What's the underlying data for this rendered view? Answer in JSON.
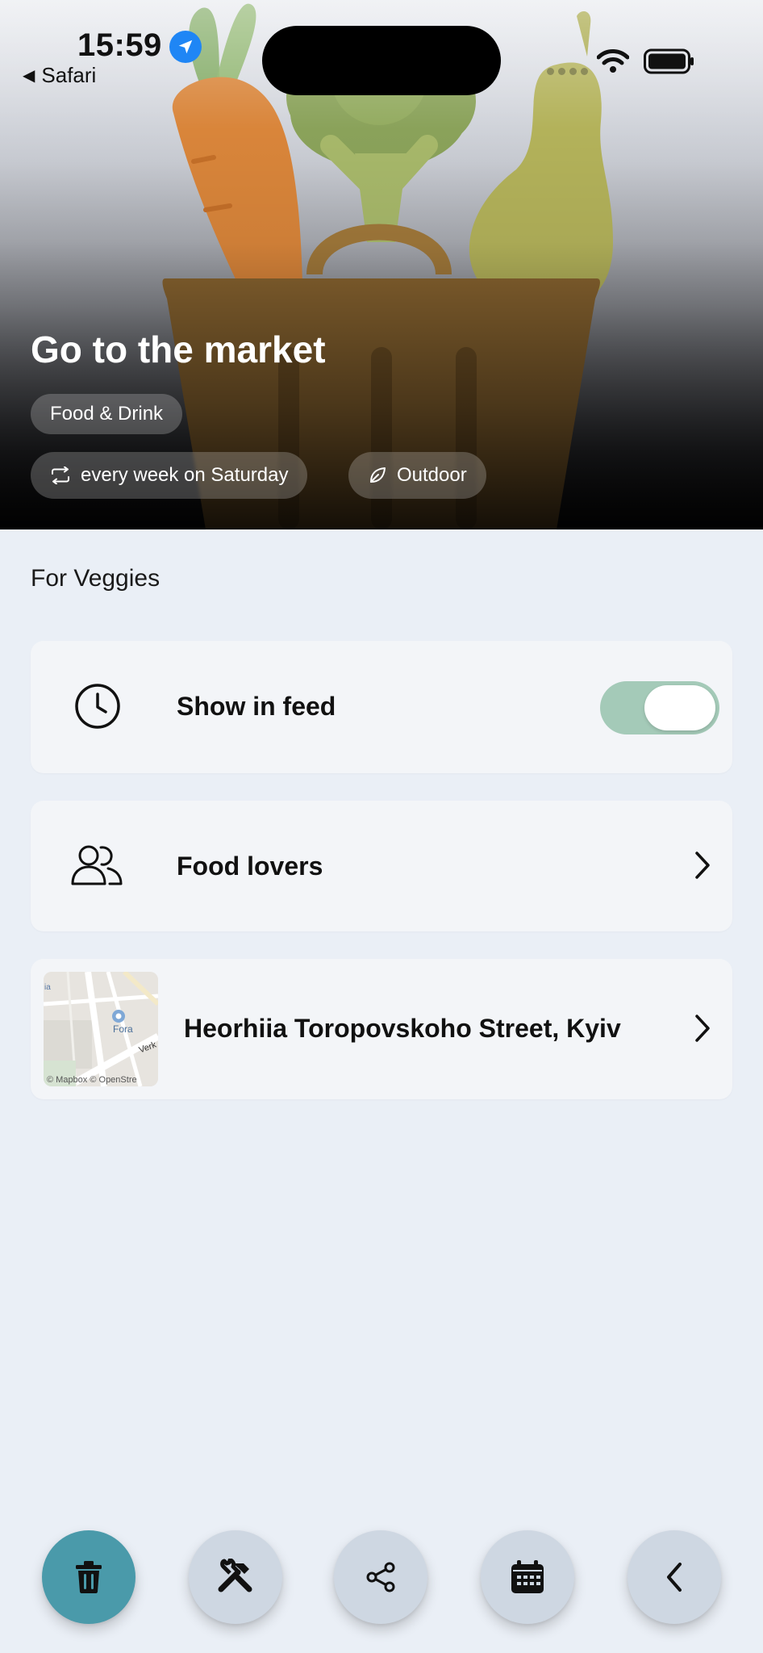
{
  "status_bar": {
    "time": "15:59",
    "back_app": "Safari"
  },
  "hero": {
    "title": "Go to the market",
    "category": "Food & Drink",
    "repeat": "every week on Saturday",
    "place_type": "Outdoor"
  },
  "main": {
    "section_title": "For Veggies",
    "show_in_feed": {
      "label": "Show in feed",
      "enabled": true
    },
    "group": {
      "label": "Food lovers"
    },
    "location": {
      "address": "Heorhiia Toropovskoho Street, Kyiv",
      "map_labels": {
        "poi": "Fora",
        "street": "Verk",
        "edge": "ia"
      },
      "map_attribution": "© Mapbox © OpenStre"
    }
  },
  "bottom_bar": {
    "buttons": [
      "delete",
      "tools",
      "share",
      "calendar",
      "back"
    ]
  },
  "colors": {
    "background": "#eaeff6",
    "card": "#f3f5f8",
    "toggle_on": "#a4cab8",
    "delete_button": "#4a9aaa",
    "action_button": "#ced7e2"
  }
}
